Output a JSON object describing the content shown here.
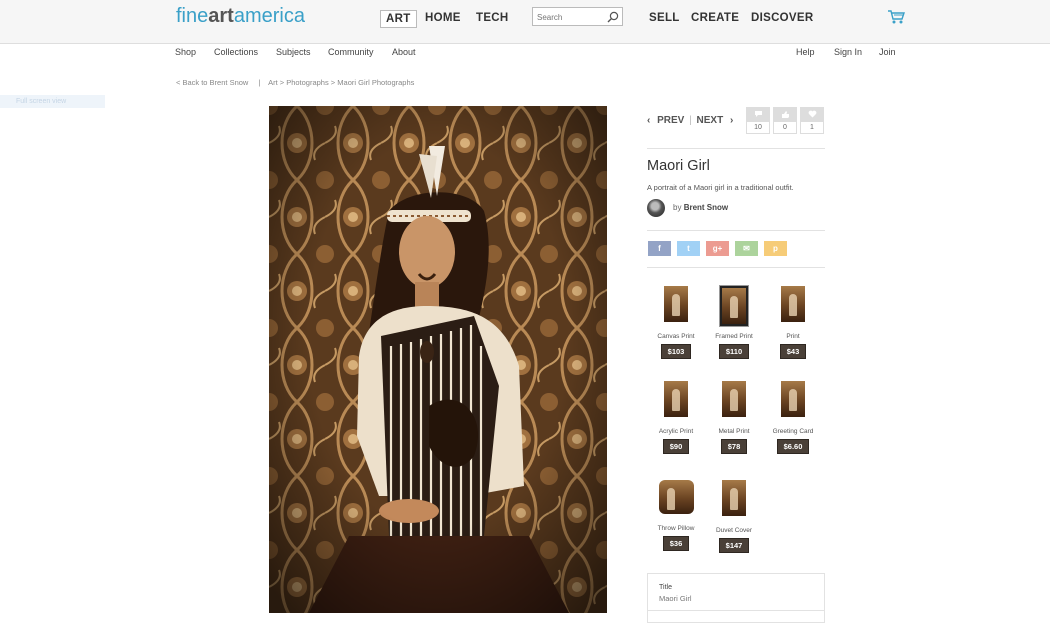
{
  "header": {
    "logo": {
      "part1": "fine",
      "part2": "art",
      "part3": "america"
    },
    "categories": [
      "ART",
      "HOME",
      "TECH"
    ],
    "search": {
      "placeholder": "Search"
    },
    "actions": [
      "SELL",
      "CREATE",
      "DISCOVER"
    ]
  },
  "subnav": {
    "left": [
      "Shop",
      "Collections",
      "Subjects",
      "Community",
      "About"
    ],
    "right": [
      "Help",
      "Sign In",
      "Join"
    ]
  },
  "breadcrumb": {
    "back": "< Back to Brent Snow",
    "separator": "|",
    "path": "Art > Photographs > Maori Girl Photographs"
  },
  "fullscreen_label": "Full screen view",
  "artwork": {
    "prev_label": "PREV",
    "next_label": "NEXT",
    "counts": [
      "10",
      "0",
      "1"
    ],
    "title": "Maori Girl",
    "description": "A portrait of a Maori girl in a traditional outfit.",
    "by_label": "by",
    "artist": "Brent Snow"
  },
  "share_buttons": [
    {
      "icon": "f",
      "color": "#3b5998"
    },
    {
      "icon": "t",
      "color": "#55acee"
    },
    {
      "icon": "g+",
      "color": "#dd4b39"
    },
    {
      "icon": "✉",
      "color": "#6ab04c"
    },
    {
      "icon": "p",
      "color": "#f0a30a"
    }
  ],
  "products": [
    {
      "label": "Canvas Print",
      "price": "$103",
      "variant": "plain"
    },
    {
      "label": "Framed Print",
      "price": "$110",
      "variant": "frame"
    },
    {
      "label": "Print",
      "price": "$43",
      "variant": "plain"
    },
    {
      "label": "Acrylic Print",
      "price": "$90",
      "variant": "plain"
    },
    {
      "label": "Metal Print",
      "price": "$78",
      "variant": "plain"
    },
    {
      "label": "Greeting Card",
      "price": "$6.60",
      "variant": "plain"
    },
    {
      "label": "Throw Pillow",
      "price": "$36",
      "variant": "pillow"
    },
    {
      "label": "Duvet Cover",
      "price": "$147",
      "variant": "plain"
    }
  ],
  "info": {
    "heading": "Title",
    "value": "Maori Girl"
  },
  "colors": {
    "brand": "#3aa0c8",
    "price_bg": "#4a4038",
    "art_dark": "#3a2212"
  }
}
